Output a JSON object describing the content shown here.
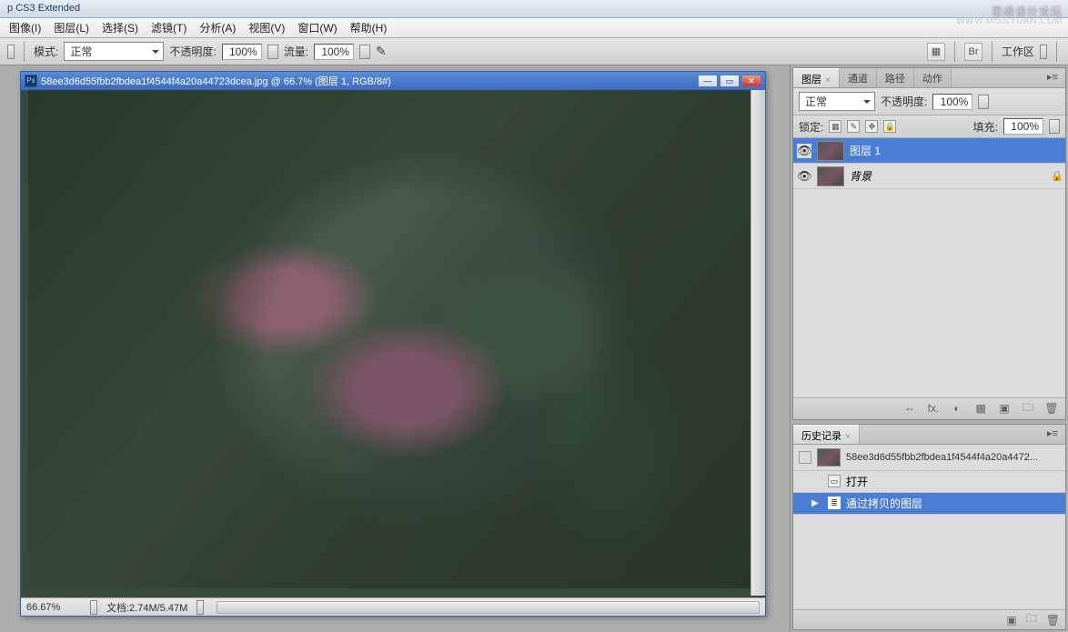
{
  "app": {
    "title": "p CS3 Extended"
  },
  "watermark": {
    "line1": "思缘设计论坛",
    "line2": "WWW.MISSYUAN.COM"
  },
  "menu": {
    "image": "图像(I)",
    "layer": "图层(L)",
    "select": "选择(S)",
    "filter": "滤镜(T)",
    "analysis": "分析(A)",
    "view": "视图(V)",
    "window": "窗口(W)",
    "help": "帮助(H)"
  },
  "options": {
    "mode_label": "模式:",
    "mode_value": "正常",
    "opacity_label": "不透明度:",
    "opacity_value": "100%",
    "flow_label": "流量:",
    "flow_value": "100%",
    "workspace_label": "工作区"
  },
  "doc": {
    "title": "58ee3d6d55fbb2fbdea1f4544f4a20a44723dcea.jpg @ 66.7%  (图层 1, RGB/8#)",
    "zoom": "66.67%",
    "docinfo": "文档:2.74M/5.47M"
  },
  "panels": {
    "layers": {
      "tabs": {
        "layers": "图层",
        "channels": "通道",
        "paths": "路径",
        "actions": "动作"
      },
      "blend_mode": "正常",
      "opacity_label": "不透明度:",
      "opacity_value": "100%",
      "lock_label": "锁定:",
      "fill_label": "填充:",
      "fill_value": "100%",
      "items": [
        {
          "name": "图层 1",
          "locked": false
        },
        {
          "name": "背景",
          "locked": true
        }
      ],
      "footer_icons": [
        "⇔",
        "fx.",
        "◐",
        "▩",
        "▣",
        "🗀",
        "🗑"
      ]
    },
    "history": {
      "tab": "历史记录",
      "doc_name": "58ee3d6d55fbb2fbdea1f4544f4a20a4472...",
      "items": [
        {
          "label": "打开"
        },
        {
          "label": "通过拷贝的图层"
        }
      ]
    }
  }
}
